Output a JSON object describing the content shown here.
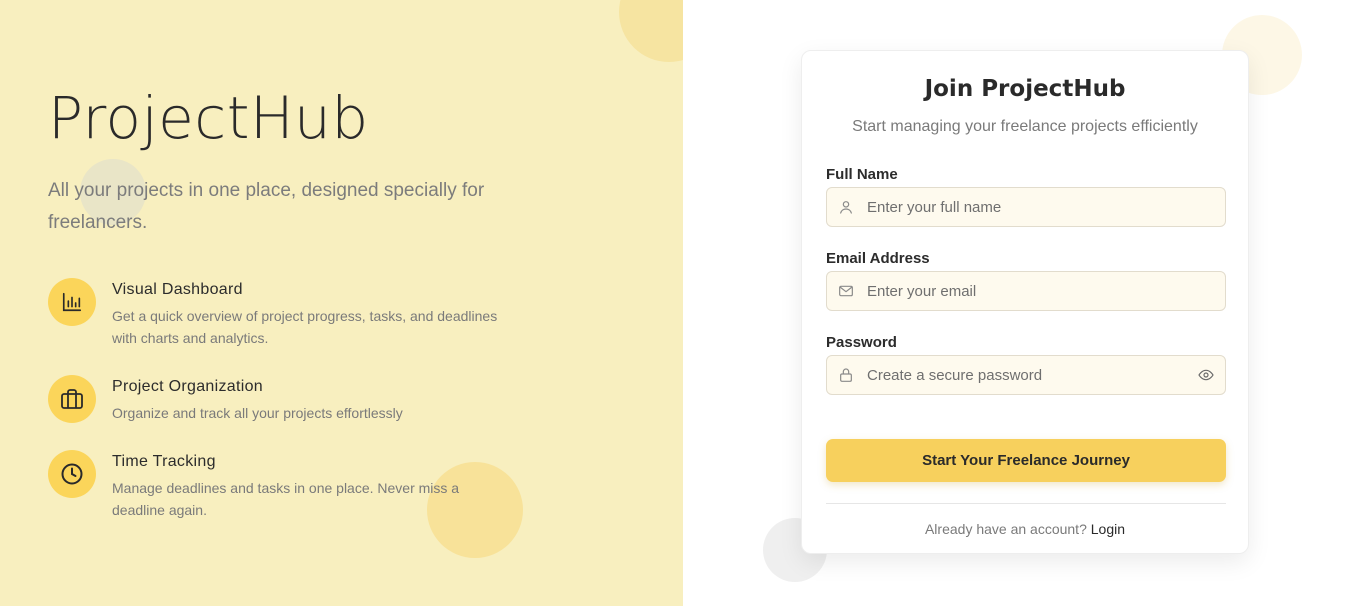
{
  "brand": {
    "name": "ProjectHub",
    "tagline": "All your projects in one place, designed specially for freelancers."
  },
  "features": [
    {
      "icon": "bar-chart-icon",
      "title": "Visual Dashboard",
      "description": "Get a quick overview of project progress, tasks, and deadlines with charts and analytics."
    },
    {
      "icon": "briefcase-icon",
      "title": "Project Organization",
      "description": "Organize and track all your projects effortlessly"
    },
    {
      "icon": "clock-icon",
      "title": "Time Tracking",
      "description": "Manage deadlines and tasks in one place. Never miss a deadline again."
    }
  ],
  "form": {
    "title": "Join ProjectHub",
    "subtitle": "Start managing your freelance projects efficiently",
    "full_name": {
      "label": "Full Name",
      "placeholder": "Enter your full name",
      "value": "",
      "icon": "user-icon"
    },
    "email": {
      "label": "Email Address",
      "placeholder": "Enter your email",
      "value": "",
      "icon": "mail-icon"
    },
    "password": {
      "label": "Password",
      "placeholder": "Create a secure password",
      "value": "",
      "icon": "lock-icon",
      "toggle_icon": "eye-icon"
    },
    "submit_label": "Start Your Freelance Journey",
    "login_prompt": "Already have an account?",
    "login_link": "Login"
  },
  "colors": {
    "left_background": "#f8efbf",
    "accent": "#fbd55a",
    "button": "#f7d05d",
    "input_background": "#fefaee"
  }
}
